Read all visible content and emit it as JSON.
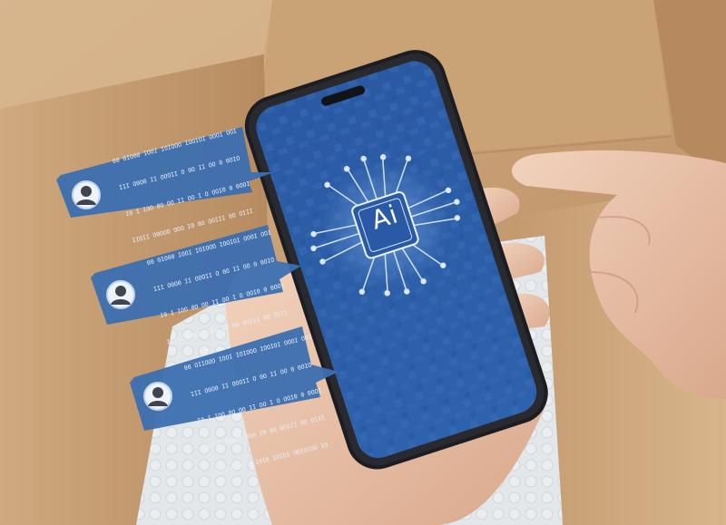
{
  "phone": {
    "chip_label": "Ai"
  },
  "chat_bubbles": [
    {
      "lines": [
        "00 0IO00 IOOI IOIOOO IOOIOI OOOI OOI",
        "III O0O0 II OOOII O 0O II OO 0 0OIO",
        "I0 I IOO 0O OO II OO I O OOI0 0 0OOI",
        "IIOII O0OOO OOO I0 0O OOIII 0O OIII",
        "I0III OOOO O I0IO IOIOI OOIOIOO IIII"
      ]
    },
    {
      "lines": [
        "00 0IO00 IOOI IOIOOO IOOIOI OOOI OOI",
        "III O0O0 II OOOII O 0O II OO 0 0OIO",
        "I0 I IOO 0O OO II OO I O OOI0 0 0OOI",
        "IIOII O0OOO OOO I0 0O OOIII 0O OIII",
        "IIIII OOOO O I0IO IOIOI OOIOIOO IO"
      ]
    },
    {
      "lines": [
        "00 OIIOOO IOOI IOIOOO IOOIOI OOOI OOI",
        "III O0O0 II OOOII O 0O II OO 0 0OIO",
        "I0 I IOO 0O OO II OO I O OOI0 0 0OOI",
        "IIOII O0OOO OOO I0 0O OOIII 0O OIII",
        "IIIII OOOO O I0IO IOIOI OOIOIOO IO"
      ]
    }
  ],
  "colors": {
    "bubble": "#3c6fb0",
    "screen": "#2f5fa8",
    "cardboard": "#c9a37b"
  },
  "icons": [
    "user-avatar-icon",
    "ai-chip-icon"
  ]
}
